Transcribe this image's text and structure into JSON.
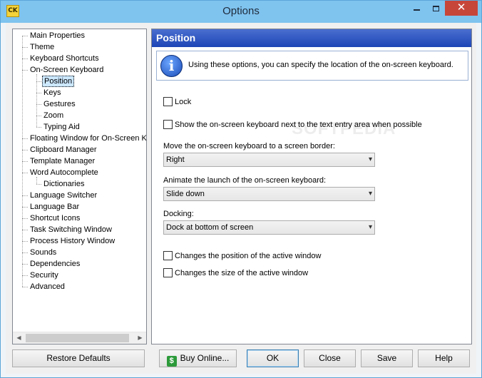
{
  "window": {
    "title": "Options",
    "icon_text": "CK",
    "close_glyph": "✕"
  },
  "tree": {
    "items": [
      {
        "label": "Main Properties",
        "level": 0
      },
      {
        "label": "Theme",
        "level": 0
      },
      {
        "label": "Keyboard Shortcuts",
        "level": 0
      },
      {
        "label": "On-Screen Keyboard",
        "level": 0
      },
      {
        "label": "Position",
        "level": 1,
        "selected": true
      },
      {
        "label": "Keys",
        "level": 1
      },
      {
        "label": "Gestures",
        "level": 1
      },
      {
        "label": "Zoom",
        "level": 1
      },
      {
        "label": "Typing Aid",
        "level": 1
      },
      {
        "label": "Floating Window for On-Screen Keyboard",
        "level": 0
      },
      {
        "label": "Clipboard Manager",
        "level": 0
      },
      {
        "label": "Template Manager",
        "level": 0
      },
      {
        "label": "Word Autocomplete",
        "level": 0
      },
      {
        "label": "Dictionaries",
        "level": 1
      },
      {
        "label": "Language Switcher",
        "level": 0
      },
      {
        "label": "Language Bar",
        "level": 0
      },
      {
        "label": "Shortcut Icons",
        "level": 0
      },
      {
        "label": "Task Switching Window",
        "level": 0
      },
      {
        "label": "Process History Window",
        "level": 0
      },
      {
        "label": "Sounds",
        "level": 0
      },
      {
        "label": "Dependencies",
        "level": 0
      },
      {
        "label": "Security",
        "level": 0
      },
      {
        "label": "Advanced",
        "level": 0
      }
    ]
  },
  "panel": {
    "title": "Position",
    "info_icon": "i",
    "info_text": "Using these options, you can specify the location of the on-screen keyboard.",
    "lock_label": "Lock",
    "show_next_label": "Show the on-screen keyboard next to the text entry area when possible",
    "border_label": "Move the on-screen keyboard to a screen border:",
    "border_value": "Right",
    "animate_label": "Animate the launch of the on-screen keyboard:",
    "animate_value": "Slide down",
    "docking_label": "Docking:",
    "docking_value": "Dock at bottom of screen",
    "change_position_label": "Changes the position of the active window",
    "change_size_label": "Changes the size of the active window",
    "watermark": "SOFTPEDIA"
  },
  "buttons": {
    "restore": "Restore Defaults",
    "buy": "Buy Online...",
    "buy_icon": "$",
    "ok": "OK",
    "close": "Close",
    "save": "Save",
    "help": "Help"
  },
  "colors": {
    "titlebar": "#7fc3ef",
    "close_button": "#c7463a",
    "panel_header": "#1d45b5",
    "selected_item": "#cce8ff"
  }
}
